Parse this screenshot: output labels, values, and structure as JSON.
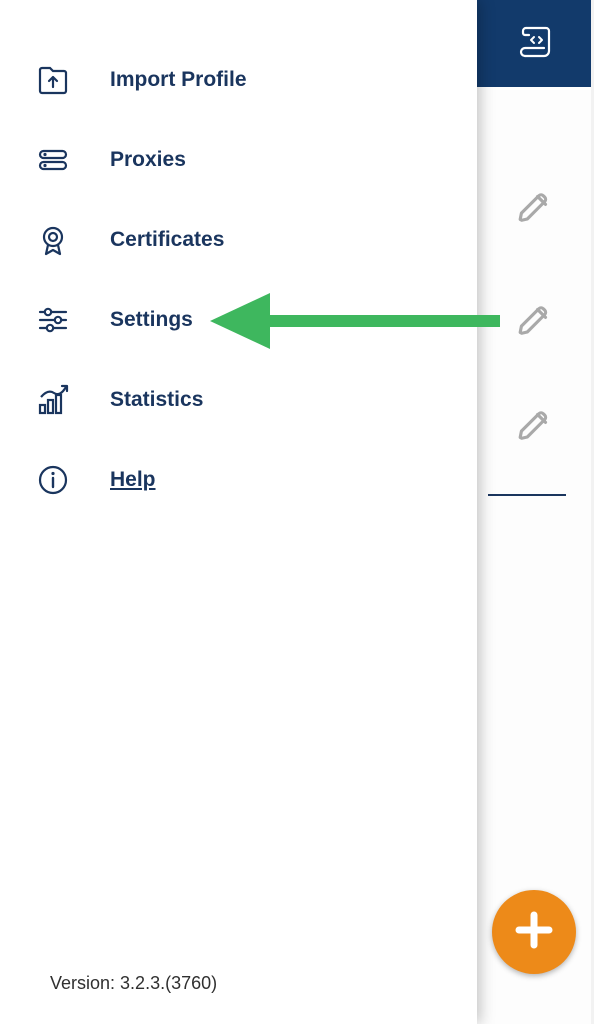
{
  "menu": {
    "items": [
      {
        "label": "Import Profile"
      },
      {
        "label": "Proxies"
      },
      {
        "label": "Certificates"
      },
      {
        "label": "Settings"
      },
      {
        "label": "Statistics"
      },
      {
        "label": "Help"
      }
    ]
  },
  "version_text": "Version: 3.2.3.(3760)",
  "colors": {
    "primary": "#1a355e",
    "header": "#123a6b",
    "fab": "#ed8a19",
    "annotation": "#3eb75e"
  }
}
